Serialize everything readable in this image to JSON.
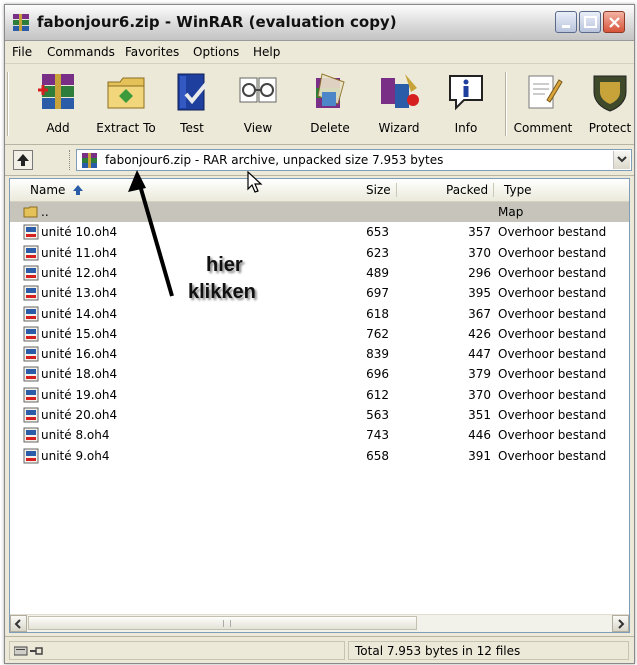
{
  "window": {
    "title": "fabonjour6.zip - WinRAR (evaluation copy)"
  },
  "menu": [
    "File",
    "Commands",
    "Favorites",
    "Options",
    "Help"
  ],
  "toolbar": {
    "add": "Add",
    "extract_to": "Extract To",
    "test": "Test",
    "view": "View",
    "delete": "Delete",
    "wizard": "Wizard",
    "info": "Info",
    "comment": "Comment",
    "protect": "Protect"
  },
  "address": {
    "text": "fabonjour6.zip - RAR archive, unpacked size 7.953 bytes"
  },
  "columns": {
    "name": "Name",
    "size": "Size",
    "packed": "Packed",
    "type": "Type"
  },
  "parent_row": {
    "name": "..",
    "type": "Map"
  },
  "files": [
    {
      "name": "unité 10.oh4",
      "size": "653",
      "packed": "357",
      "type": "Overhoor bestand"
    },
    {
      "name": "unité 11.oh4",
      "size": "623",
      "packed": "370",
      "type": "Overhoor bestand"
    },
    {
      "name": "unité 12.oh4",
      "size": "489",
      "packed": "296",
      "type": "Overhoor bestand"
    },
    {
      "name": "unité 13.oh4",
      "size": "697",
      "packed": "395",
      "type": "Overhoor bestand"
    },
    {
      "name": "unité 14.oh4",
      "size": "618",
      "packed": "367",
      "type": "Overhoor bestand"
    },
    {
      "name": "unité 15.oh4",
      "size": "762",
      "packed": "426",
      "type": "Overhoor bestand"
    },
    {
      "name": "unité 16.oh4",
      "size": "839",
      "packed": "447",
      "type": "Overhoor bestand"
    },
    {
      "name": "unité 18.oh4",
      "size": "696",
      "packed": "379",
      "type": "Overhoor bestand"
    },
    {
      "name": "unité 19.oh4",
      "size": "612",
      "packed": "370",
      "type": "Overhoor bestand"
    },
    {
      "name": "unité 20.oh4",
      "size": "563",
      "packed": "351",
      "type": "Overhoor bestand"
    },
    {
      "name": "unité 8.oh4",
      "size": "743",
      "packed": "446",
      "type": "Overhoor bestand"
    },
    {
      "name": "unité 9.oh4",
      "size": "658",
      "packed": "391",
      "type": "Overhoor bestand"
    }
  ],
  "status": {
    "total": "Total 7.953 bytes in 12 files"
  },
  "annotation": {
    "line1": "hier",
    "line2": "klikken"
  }
}
